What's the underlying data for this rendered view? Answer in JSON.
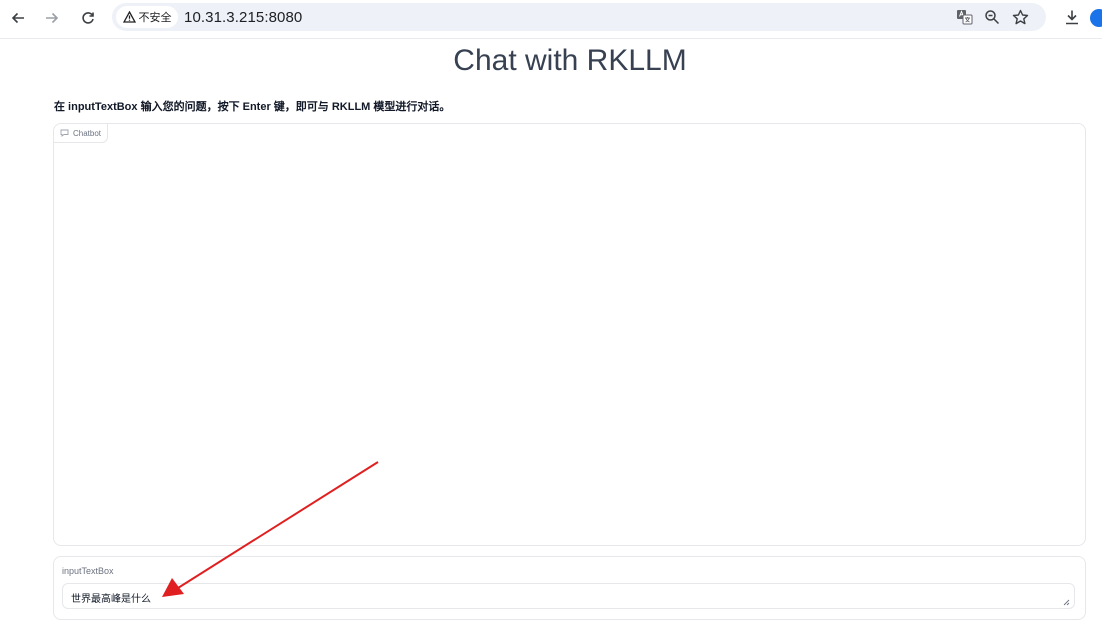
{
  "browser": {
    "security_label": "不安全",
    "url": "10.31.3.215:8080",
    "nav": {
      "back_icon": "arrow-left-icon",
      "forward_icon": "arrow-right-icon",
      "reload_icon": "reload-icon"
    },
    "omnibox_icons": [
      "translate-icon",
      "zoom-icon",
      "star-icon"
    ],
    "toolbar_icons": [
      "download-icon",
      "profile-icon"
    ]
  },
  "page": {
    "title": "Chat with RKLLM",
    "description": "在 inputTextBox 输入您的问题，按下 Enter 键，即可与 RKLLM 模型进行对话。",
    "chatbot": {
      "label": "Chatbot",
      "icon": "chat-icon",
      "messages": []
    },
    "input": {
      "label": "inputTextBox",
      "value": "世界最高峰是什么"
    }
  },
  "annotation": {
    "type": "arrow",
    "color": "#e02020"
  }
}
